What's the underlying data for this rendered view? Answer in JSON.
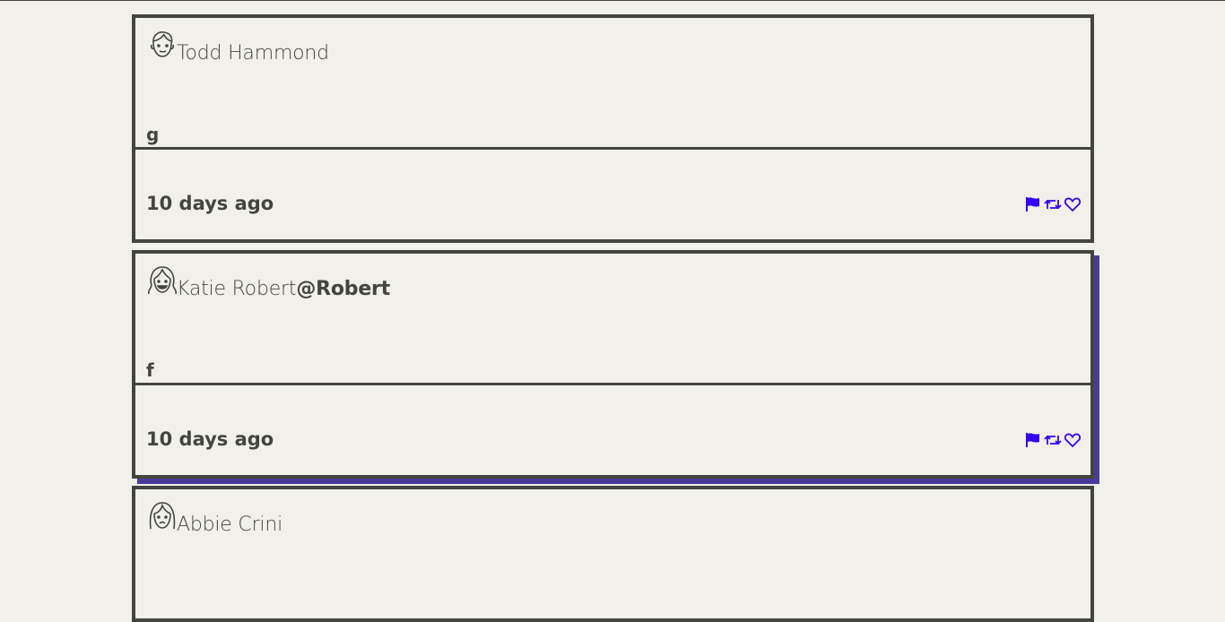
{
  "accent_color": "#4a3a9a",
  "action_icon_color": "#3300ff",
  "tweets": [
    {
      "avatar_icon": "face-man-icon",
      "author": "Todd Hammond",
      "handle": "",
      "content": "g",
      "time": "10 days ago",
      "active": false
    },
    {
      "avatar_icon": "face-woman-smiling-icon",
      "author": "Katie Robert",
      "handle": "@Robert",
      "content": "f",
      "time": "10 days ago",
      "active": true
    },
    {
      "avatar_icon": "face-woman-icon",
      "author": "Abbie Crini",
      "handle": "",
      "content": "",
      "time": "",
      "active": false
    }
  ],
  "actions": [
    {
      "icon": "flag-icon"
    },
    {
      "icon": "retweet-icon"
    },
    {
      "icon": "heart-icon"
    }
  ]
}
